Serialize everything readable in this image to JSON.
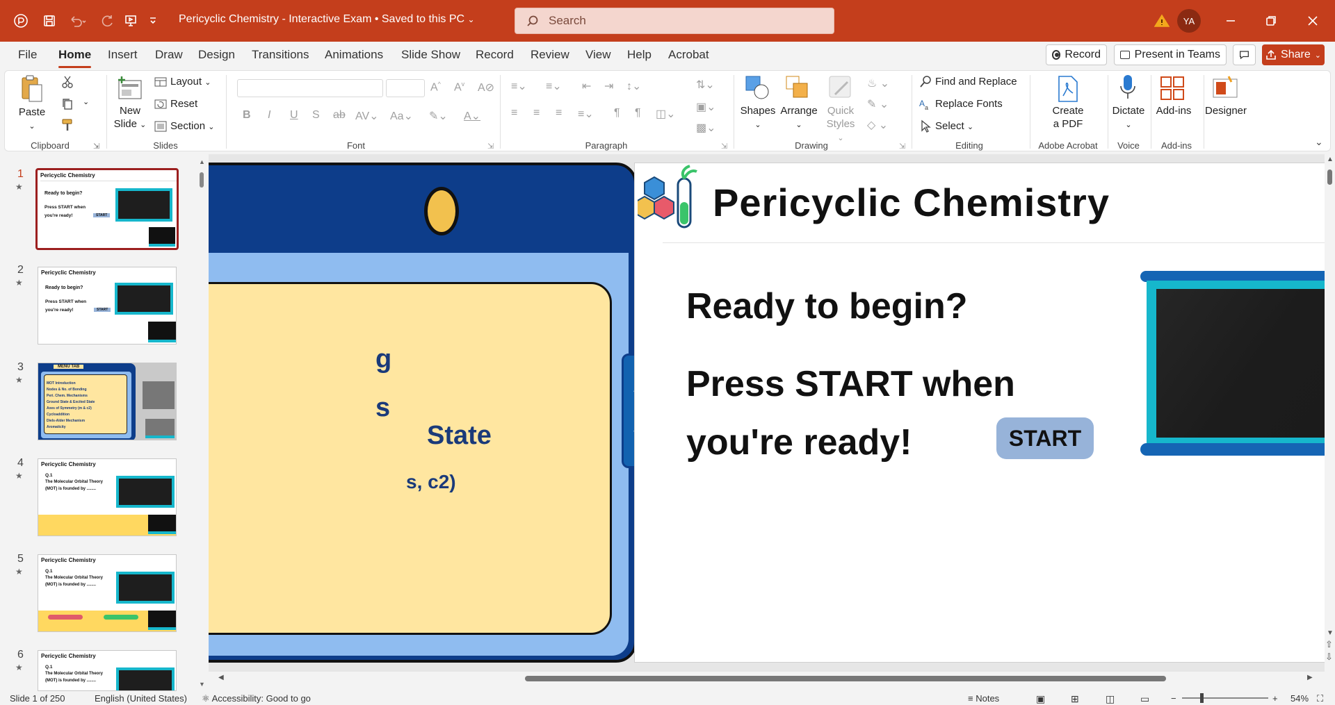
{
  "titlebar": {
    "doc_title": "Pericyclic Chemistry - Interactive Exam  •  Saved to this PC",
    "search_placeholder": "Search",
    "avatar_initials": "YA",
    "accent_color": "#c43e1c"
  },
  "tabs": [
    "File",
    "Home",
    "Insert",
    "Draw",
    "Design",
    "Transitions",
    "Animations",
    "Slide Show",
    "Record",
    "Review",
    "View",
    "Help",
    "Acrobat"
  ],
  "active_tab": "Home",
  "ribbon_right": {
    "record": "Record",
    "present": "Present in Teams",
    "share": "Share"
  },
  "ribbon": {
    "clipboard": {
      "paste": "Paste",
      "label": "Clipboard"
    },
    "slides": {
      "new_slide_1": "New",
      "new_slide_2": "Slide",
      "layout": "Layout",
      "reset": "Reset",
      "section": "Section",
      "label": "Slides"
    },
    "font": {
      "label": "Font"
    },
    "paragraph": {
      "label": "Paragraph"
    },
    "drawing": {
      "shapes": "Shapes",
      "arrange": "Arrange",
      "quick_styles_1": "Quick",
      "quick_styles_2": "Styles",
      "label": "Drawing"
    },
    "editing": {
      "find_replace": "Find and Replace",
      "replace_fonts": "Replace Fonts",
      "select": "Select",
      "label": "Editing"
    },
    "acrobat": {
      "create_1": "Create",
      "create_2": "a PDF",
      "label": "Adobe Acrobat"
    },
    "voice": {
      "dictate": "Dictate",
      "label": "Voice"
    },
    "addins": {
      "addins": "Add-ins",
      "label": "Add-ins"
    },
    "designer": {
      "designer": "Designer"
    }
  },
  "thumbnails": [
    {
      "num": "1",
      "title": "Pericyclic Chemistry",
      "line1": "Ready to begin?",
      "line2": "Press START when",
      "line3": "you're ready!",
      "button": "START"
    },
    {
      "num": "2",
      "title": "Pericyclic Chemistry",
      "line1": "Ready to begin?",
      "line2": "Press START when",
      "line3": "you're ready!",
      "button": "START"
    },
    {
      "num": "3",
      "title": "MENU TAB",
      "items": [
        "MOT Introduction",
        "Nodes & No. of Bonding",
        "Peri. Chem. Mechanisms",
        "Ground State & Excited State",
        "Axes of Symmetry (m & c2)",
        "Cycloaddition",
        "Diels-Alder Mechanism",
        "Aromaticity"
      ]
    },
    {
      "num": "4",
      "title": "Pericyclic Chemistry",
      "q": "Q.1",
      "line1": "The Molecular Orbital Theory",
      "line2": "(MOT) is founded  by ........"
    },
    {
      "num": "5",
      "title": "Pericyclic Chemistry",
      "q": "Q.1",
      "line1": "The Molecular Orbital Theory",
      "line2": "(MOT) is founded  by ........"
    },
    {
      "num": "6",
      "title": "Pericyclic Chemistry",
      "q": "Q.1",
      "line1": "The Molecular Orbital Theory",
      "line2": "(MOT) is founded  by ........"
    }
  ],
  "prev_slide": {
    "frag1": "g",
    "frag2": "s",
    "frag3": "State",
    "frag4": "s, c2)"
  },
  "slide": {
    "title": "Pericyclic Chemistry",
    "line1": "Ready to begin?",
    "line2": "Press START when",
    "line3": "you're ready!",
    "start_button": "START",
    "colors": {
      "start_button": "#97b3d9",
      "monitor_frame": "#16b7cc",
      "monitor_bar": "#1565b4",
      "screen": "#1c1c1c"
    }
  },
  "statusbar": {
    "slide_count": "Slide 1 of 250",
    "language": "English (United States)",
    "accessibility": "Accessibility: Good to go",
    "notes": "Notes",
    "zoom": "54%"
  }
}
